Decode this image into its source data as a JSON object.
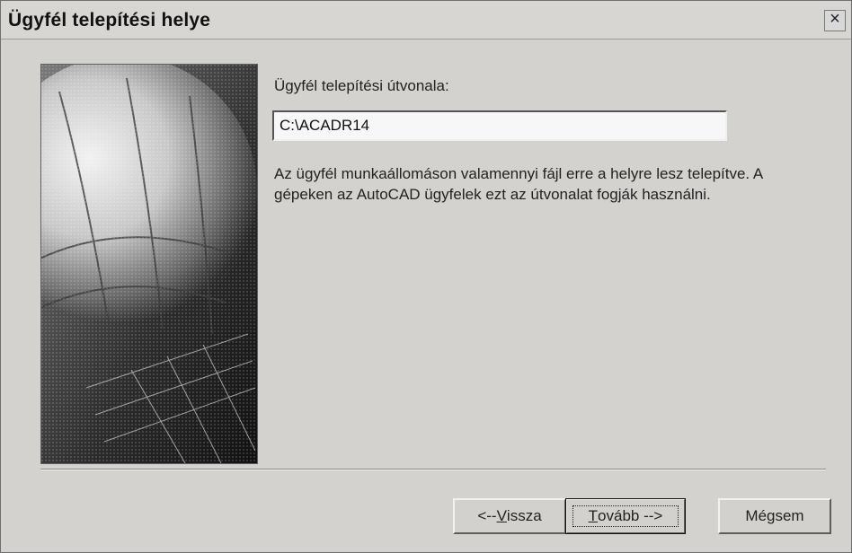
{
  "window": {
    "title": "Ügyfél telepítési helye",
    "close_glyph": "×"
  },
  "form": {
    "label_prefix": "Ü",
    "label_mnemonic": "g",
    "label_rest": "yfél telepítési útvonala:",
    "path_value": "C:\\ACADR14",
    "description": "Az ügyfél munkaállomáson valamennyi fájl erre a helyre lesz telepítve.  A gépeken az AutoCAD ügyfelek ezt az útvonalat fogják használni."
  },
  "buttons": {
    "back_prefix": "<--",
    "back_mnemonic": "V",
    "back_rest": "issza",
    "next_mnemonic": "T",
    "next_rest": "ovább -->",
    "cancel_label": "Mégsem"
  },
  "icons": {
    "close": "close-icon",
    "wizard_image": "globe-grid-image"
  }
}
